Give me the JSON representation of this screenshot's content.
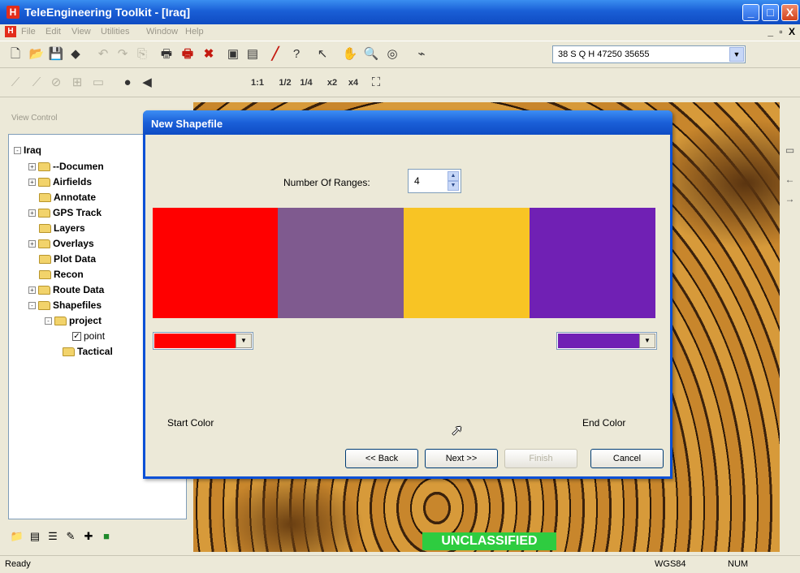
{
  "app": {
    "icon": "H",
    "title": "TeleEngineering Toolkit - [Iraq]",
    "window_buttons": {
      "minimize": "_",
      "maximize": "□",
      "close": "X"
    }
  },
  "menu": {
    "items": [
      "File",
      "Edit",
      "View",
      "Utilities",
      "Window",
      "Help"
    ],
    "mdi_buttons": "_ ▫ X"
  },
  "toolbar": {
    "coordinate": "38 S Q H 47250 35655",
    "zoom_labels": [
      "1:1",
      "1/2",
      "1/4",
      "x2",
      "x4"
    ]
  },
  "left_panel": {
    "label": "View Control",
    "tree": [
      {
        "label": "Iraq",
        "expander": "-",
        "folder": false
      },
      {
        "label": "--Documen",
        "expander": "+",
        "folder": true
      },
      {
        "label": "Airfields",
        "expander": "+",
        "folder": true
      },
      {
        "label": "Annotate",
        "expander": "",
        "folder": true
      },
      {
        "label": "GPS Track",
        "expander": "+",
        "folder": true
      },
      {
        "label": "Layers",
        "expander": "",
        "folder": true
      },
      {
        "label": "Overlays",
        "expander": "+",
        "folder": true
      },
      {
        "label": "Plot Data",
        "expander": "",
        "folder": true
      },
      {
        "label": "Recon",
        "expander": "",
        "folder": true
      },
      {
        "label": "Route Data",
        "expander": "+",
        "folder": true
      },
      {
        "label": "Shapefiles",
        "expander": "-",
        "folder": true
      },
      {
        "label": "project",
        "expander": "-",
        "folder": true
      },
      {
        "label": "point",
        "expander": "",
        "folder": false,
        "checked": "✓"
      },
      {
        "label": "Tactical",
        "expander": "",
        "folder": true
      }
    ]
  },
  "map": {
    "overlay_label": "UNCLASSIFIED"
  },
  "status": {
    "left": "Ready",
    "datum": "WGS84",
    "num": "NUM"
  },
  "dialog": {
    "title": "New Shapefile",
    "ranges_label": "Number Of Ranges:",
    "ranges_value": "4",
    "swatches": [
      "#ff0000",
      "#7f5a8f",
      "#f8c424",
      "#7020b4"
    ],
    "start_color": "#ff0000",
    "end_color": "#7020b4",
    "start_label": "Start Color",
    "end_label": "End Color",
    "buttons": {
      "back": "<< Back",
      "next": "Next >>",
      "finish": "Finish",
      "cancel": "Cancel"
    }
  }
}
